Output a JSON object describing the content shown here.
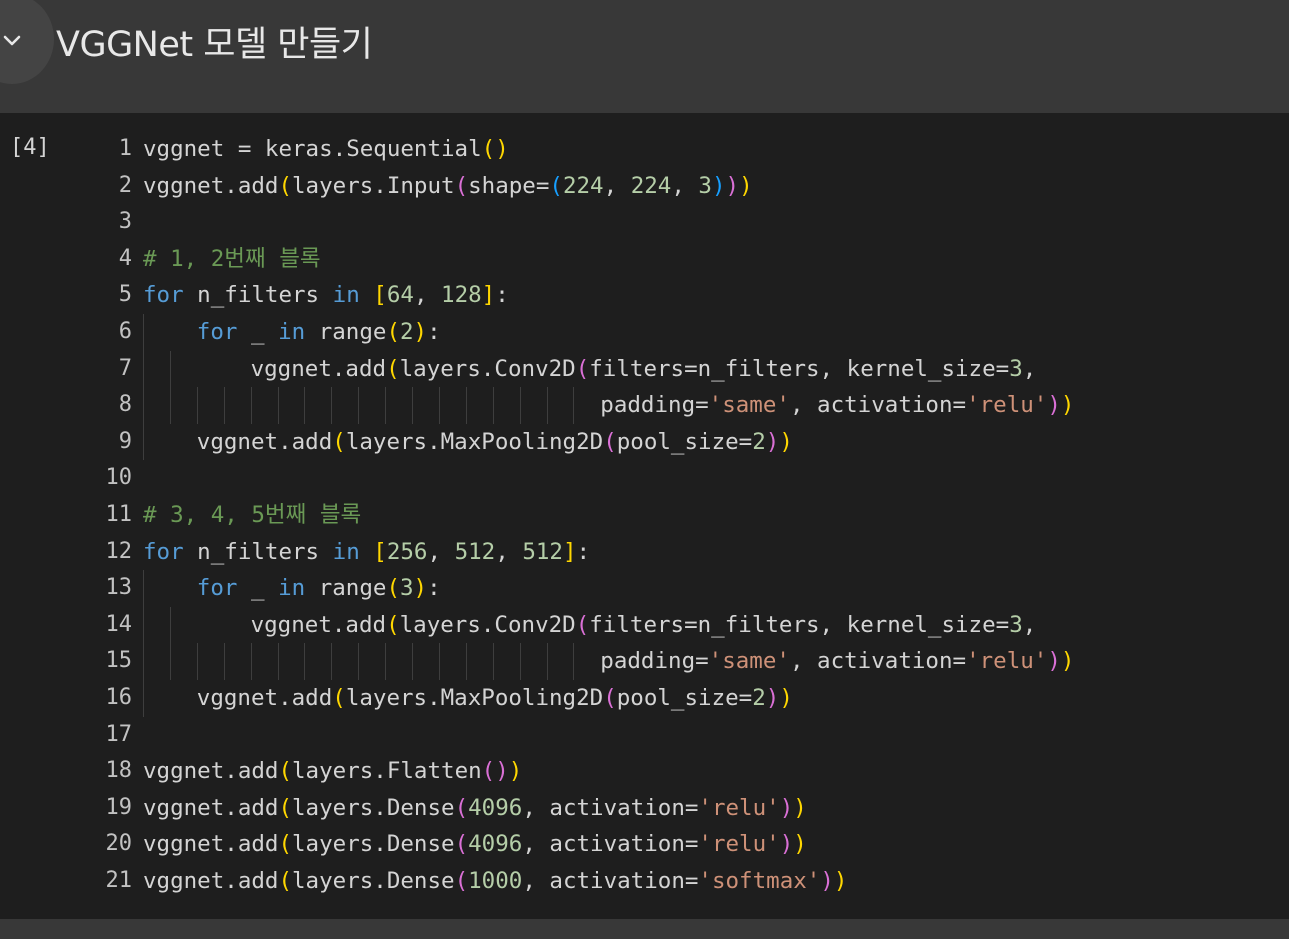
{
  "section": {
    "title": "VGGNet 모델 만들기"
  },
  "cell": {
    "execution_count": "[4]",
    "lines": [
      {
        "n": "1",
        "indent": 0,
        "guides": 0,
        "tokens": [
          [
            "vggnet = keras.Sequential",
            "#d4d4d4"
          ],
          [
            "(",
            "#ffd700"
          ],
          [
            ")",
            "#ffd700"
          ]
        ]
      },
      {
        "n": "2",
        "indent": 0,
        "guides": 0,
        "tokens": [
          [
            "vggnet.add",
            "#d4d4d4"
          ],
          [
            "(",
            "#ffd700"
          ],
          [
            "layers.Input",
            "#d4d4d4"
          ],
          [
            "(",
            "#da70d6"
          ],
          [
            "shape=",
            "#d4d4d4"
          ],
          [
            "(",
            "#179fff"
          ],
          [
            "224",
            "#b5cea8"
          ],
          [
            ", ",
            "#d4d4d4"
          ],
          [
            "224",
            "#b5cea8"
          ],
          [
            ", ",
            "#d4d4d4"
          ],
          [
            "3",
            "#b5cea8"
          ],
          [
            ")",
            "#179fff"
          ],
          [
            ")",
            "#da70d6"
          ],
          [
            ")",
            "#ffd700"
          ]
        ]
      },
      {
        "n": "3",
        "indent": 0,
        "guides": 0,
        "tokens": []
      },
      {
        "n": "4",
        "indent": 0,
        "guides": 0,
        "tokens": [
          [
            "# 1, 2번째 블록",
            "#6a9955"
          ]
        ]
      },
      {
        "n": "5",
        "indent": 0,
        "guides": 0,
        "tokens": [
          [
            "for",
            "#569cd6"
          ],
          [
            " n_filters ",
            "#d4d4d4"
          ],
          [
            "in",
            "#569cd6"
          ],
          [
            " ",
            "#d4d4d4"
          ],
          [
            "[",
            "#ffd700"
          ],
          [
            "64",
            "#b5cea8"
          ],
          [
            ", ",
            "#d4d4d4"
          ],
          [
            "128",
            "#b5cea8"
          ],
          [
            "]",
            "#ffd700"
          ],
          [
            ":",
            "#d4d4d4"
          ]
        ]
      },
      {
        "n": "6",
        "indent": 2,
        "guides": 1,
        "tokens": [
          [
            "for",
            "#569cd6"
          ],
          [
            " _ ",
            "#d4d4d4"
          ],
          [
            "in",
            "#569cd6"
          ],
          [
            " range",
            "#d4d4d4"
          ],
          [
            "(",
            "#ffd700"
          ],
          [
            "2",
            "#b5cea8"
          ],
          [
            ")",
            "#ffd700"
          ],
          [
            ":",
            "#d4d4d4"
          ]
        ]
      },
      {
        "n": "7",
        "indent": 4,
        "guides": 2,
        "tokens": [
          [
            "vggnet.add",
            "#d4d4d4"
          ],
          [
            "(",
            "#ffd700"
          ],
          [
            "layers.Conv2D",
            "#d4d4d4"
          ],
          [
            "(",
            "#da70d6"
          ],
          [
            "filters=n_filters, kernel_size=",
            "#d4d4d4"
          ],
          [
            "3",
            "#b5cea8"
          ],
          [
            ",",
            "#d4d4d4"
          ]
        ]
      },
      {
        "n": "8",
        "indent": 17,
        "guides": 17,
        "tokens": [
          [
            "padding=",
            "#d4d4d4"
          ],
          [
            "'same'",
            "#ce9178"
          ],
          [
            ", activation=",
            "#d4d4d4"
          ],
          [
            "'relu'",
            "#ce9178"
          ],
          [
            ")",
            "#da70d6"
          ],
          [
            ")",
            "#ffd700"
          ]
        ]
      },
      {
        "n": "9",
        "indent": 2,
        "guides": 1,
        "tokens": [
          [
            "vggnet.add",
            "#d4d4d4"
          ],
          [
            "(",
            "#ffd700"
          ],
          [
            "layers.MaxPooling2D",
            "#d4d4d4"
          ],
          [
            "(",
            "#da70d6"
          ],
          [
            "pool_size=",
            "#d4d4d4"
          ],
          [
            "2",
            "#b5cea8"
          ],
          [
            ")",
            "#da70d6"
          ],
          [
            ")",
            "#ffd700"
          ]
        ]
      },
      {
        "n": "10",
        "indent": 0,
        "guides": 0,
        "tokens": []
      },
      {
        "n": "11",
        "indent": 0,
        "guides": 0,
        "tokens": [
          [
            "# 3, 4, 5번째 블록",
            "#6a9955"
          ]
        ]
      },
      {
        "n": "12",
        "indent": 0,
        "guides": 0,
        "tokens": [
          [
            "for",
            "#569cd6"
          ],
          [
            " n_filters ",
            "#d4d4d4"
          ],
          [
            "in",
            "#569cd6"
          ],
          [
            " ",
            "#d4d4d4"
          ],
          [
            "[",
            "#ffd700"
          ],
          [
            "256",
            "#b5cea8"
          ],
          [
            ", ",
            "#d4d4d4"
          ],
          [
            "512",
            "#b5cea8"
          ],
          [
            ", ",
            "#d4d4d4"
          ],
          [
            "512",
            "#b5cea8"
          ],
          [
            "]",
            "#ffd700"
          ],
          [
            ":",
            "#d4d4d4"
          ]
        ]
      },
      {
        "n": "13",
        "indent": 2,
        "guides": 1,
        "tokens": [
          [
            "for",
            "#569cd6"
          ],
          [
            " _ ",
            "#d4d4d4"
          ],
          [
            "in",
            "#569cd6"
          ],
          [
            " range",
            "#d4d4d4"
          ],
          [
            "(",
            "#ffd700"
          ],
          [
            "3",
            "#b5cea8"
          ],
          [
            ")",
            "#ffd700"
          ],
          [
            ":",
            "#d4d4d4"
          ]
        ]
      },
      {
        "n": "14",
        "indent": 4,
        "guides": 2,
        "tokens": [
          [
            "vggnet.add",
            "#d4d4d4"
          ],
          [
            "(",
            "#ffd700"
          ],
          [
            "layers.Conv2D",
            "#d4d4d4"
          ],
          [
            "(",
            "#da70d6"
          ],
          [
            "filters=n_filters, kernel_size=",
            "#d4d4d4"
          ],
          [
            "3",
            "#b5cea8"
          ],
          [
            ",",
            "#d4d4d4"
          ]
        ]
      },
      {
        "n": "15",
        "indent": 17,
        "guides": 17,
        "tokens": [
          [
            "padding=",
            "#d4d4d4"
          ],
          [
            "'same'",
            "#ce9178"
          ],
          [
            ", activation=",
            "#d4d4d4"
          ],
          [
            "'relu'",
            "#ce9178"
          ],
          [
            ")",
            "#da70d6"
          ],
          [
            ")",
            "#ffd700"
          ]
        ]
      },
      {
        "n": "16",
        "indent": 2,
        "guides": 1,
        "tokens": [
          [
            "vggnet.add",
            "#d4d4d4"
          ],
          [
            "(",
            "#ffd700"
          ],
          [
            "layers.MaxPooling2D",
            "#d4d4d4"
          ],
          [
            "(",
            "#da70d6"
          ],
          [
            "pool_size=",
            "#d4d4d4"
          ],
          [
            "2",
            "#b5cea8"
          ],
          [
            ")",
            "#da70d6"
          ],
          [
            ")",
            "#ffd700"
          ]
        ]
      },
      {
        "n": "17",
        "indent": 0,
        "guides": 0,
        "tokens": []
      },
      {
        "n": "18",
        "indent": 0,
        "guides": 0,
        "tokens": [
          [
            "vggnet.add",
            "#d4d4d4"
          ],
          [
            "(",
            "#ffd700"
          ],
          [
            "layers.Flatten",
            "#d4d4d4"
          ],
          [
            "(",
            "#da70d6"
          ],
          [
            ")",
            "#da70d6"
          ],
          [
            ")",
            "#ffd700"
          ]
        ]
      },
      {
        "n": "19",
        "indent": 0,
        "guides": 0,
        "tokens": [
          [
            "vggnet.add",
            "#d4d4d4"
          ],
          [
            "(",
            "#ffd700"
          ],
          [
            "layers.Dense",
            "#d4d4d4"
          ],
          [
            "(",
            "#da70d6"
          ],
          [
            "4096",
            "#b5cea8"
          ],
          [
            ", activation=",
            "#d4d4d4"
          ],
          [
            "'relu'",
            "#ce9178"
          ],
          [
            ")",
            "#da70d6"
          ],
          [
            ")",
            "#ffd700"
          ]
        ]
      },
      {
        "n": "20",
        "indent": 0,
        "guides": 0,
        "tokens": [
          [
            "vggnet.add",
            "#d4d4d4"
          ],
          [
            "(",
            "#ffd700"
          ],
          [
            "layers.Dense",
            "#d4d4d4"
          ],
          [
            "(",
            "#da70d6"
          ],
          [
            "4096",
            "#b5cea8"
          ],
          [
            ", activation=",
            "#d4d4d4"
          ],
          [
            "'relu'",
            "#ce9178"
          ],
          [
            ")",
            "#da70d6"
          ],
          [
            ")",
            "#ffd700"
          ]
        ]
      },
      {
        "n": "21",
        "indent": 0,
        "guides": 0,
        "tokens": [
          [
            "vggnet.add",
            "#d4d4d4"
          ],
          [
            "(",
            "#ffd700"
          ],
          [
            "layers.Dense",
            "#d4d4d4"
          ],
          [
            "(",
            "#da70d6"
          ],
          [
            "1000",
            "#b5cea8"
          ],
          [
            ", activation=",
            "#d4d4d4"
          ],
          [
            "'softmax'",
            "#ce9178"
          ],
          [
            ")",
            "#da70d6"
          ],
          [
            ")",
            "#ffd700"
          ]
        ]
      }
    ]
  },
  "icons": {
    "collapse": "chevron-down-icon"
  },
  "colors": {
    "header_bg": "#383838",
    "cell_bg": "#1e1e1e",
    "keyword": "#569cd6",
    "number": "#b5cea8",
    "string": "#ce9178",
    "comment": "#6a9955"
  }
}
